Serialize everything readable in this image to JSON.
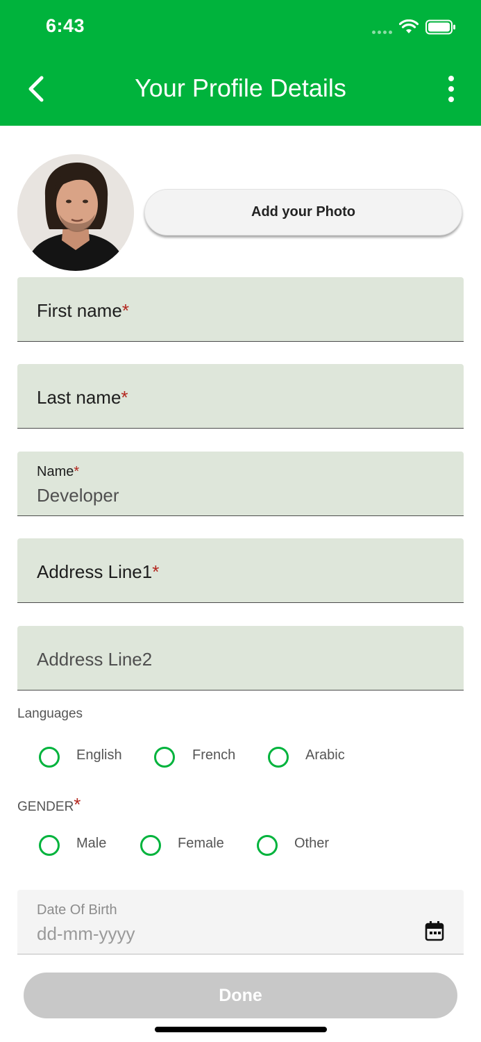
{
  "status_bar": {
    "time": "6:43"
  },
  "header": {
    "title": "Your Profile Details",
    "back_icon": "chevron-left-icon",
    "more_icon": "more-vertical-icon"
  },
  "profile": {
    "add_photo_label": "Add your Photo",
    "avatar_icon": "user-photo"
  },
  "fields": {
    "first_name": {
      "label": "First name",
      "required": "*"
    },
    "last_name": {
      "label": "Last name",
      "required": "*"
    },
    "name": {
      "label": "Name",
      "required": "*",
      "value": "Developer"
    },
    "address1": {
      "label": "Address Line1",
      "required": "*"
    },
    "address2": {
      "label": "Address Line2"
    }
  },
  "languages": {
    "label": "Languages",
    "options": [
      "English",
      "French",
      "Arabic"
    ]
  },
  "gender": {
    "label": "GENDER",
    "required": "*",
    "options": [
      "Male",
      "Female",
      "Other"
    ]
  },
  "dob": {
    "label": "Date Of Birth",
    "placeholder": "dd-mm-yyyy",
    "icon": "calendar-icon"
  },
  "done_label": "Done",
  "colors": {
    "primary": "#00b33c",
    "field_bg": "#dee6da",
    "required": "#b3261e",
    "disabled": "#c8c8c8"
  }
}
